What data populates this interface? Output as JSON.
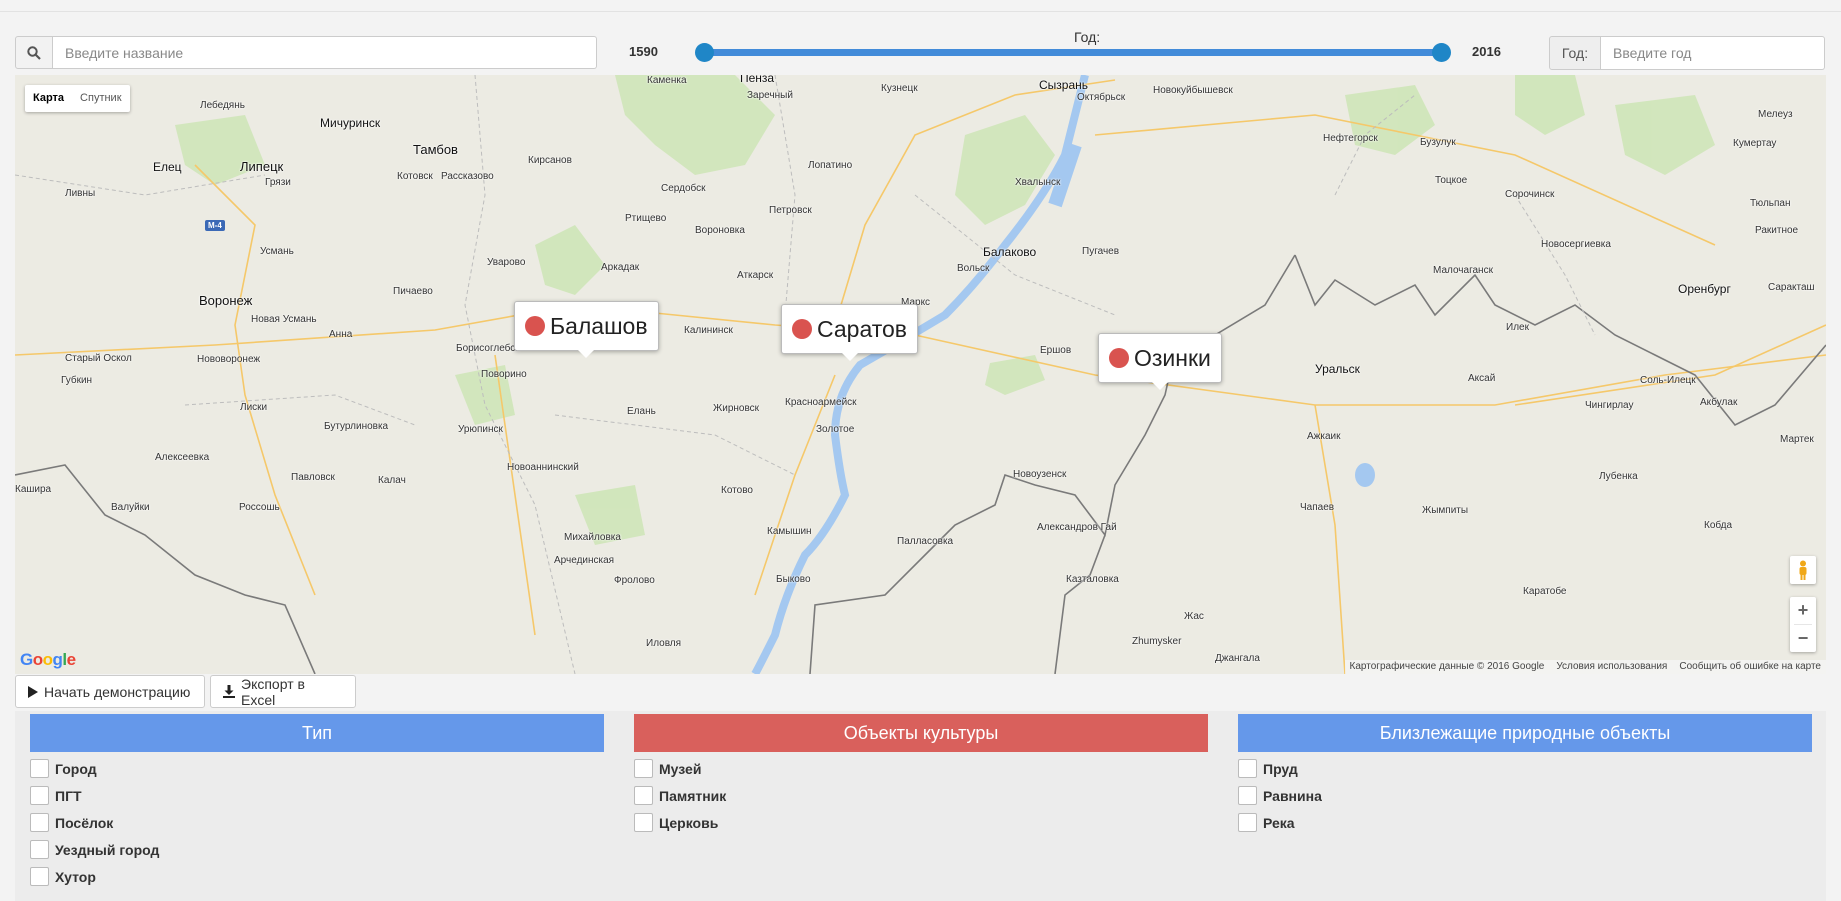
{
  "search": {
    "placeholder": "Введите название"
  },
  "year_slider": {
    "label": "Год:",
    "min": "1590",
    "max": "2016"
  },
  "year_filter": {
    "addon": "Год:",
    "placeholder": "Введите год"
  },
  "map": {
    "type_controls": [
      "Карта",
      "Спутник"
    ],
    "active_type": "Карта",
    "attribution": [
      "Картографические данные © 2016 Google",
      "Условия использования",
      "Сообщить об ошибке на карте"
    ],
    "logo": "Google",
    "zoom_in": "+",
    "zoom_out": "−",
    "road_badge": "M-4",
    "markers": [
      {
        "name": "Балашов"
      },
      {
        "name": "Саратов"
      },
      {
        "name": "Озинки"
      }
    ],
    "places": [
      "Каменка",
      "Пенза",
      "Заречный",
      "Кузнецк",
      "Сызрань",
      "Новокуйбышевск",
      "Октябрьск",
      "Лебедянь",
      "Мичуринск",
      "Тамбов",
      "Кирсанов",
      "Лопатино",
      "Хвалынск",
      "Мелеуз",
      "Кумертау",
      "Нефтегорск",
      "Бузулук",
      "Елец",
      "Липецк",
      "Котовск",
      "Рассказово",
      "Грязи",
      "Сердобск",
      "Ливны",
      "Петровск",
      "Ртищево",
      "Вольск",
      "Балаково",
      "Пугачев",
      "Тоцкое",
      "Сорочинск",
      "Тюльпан",
      "Усмань",
      "Уварово",
      "Аркадак",
      "Аткарск",
      "Маркс",
      "Новосергиевка",
      "Малочаганск",
      "Оренбург",
      "Саракташ",
      "Воронеж",
      "Новая Усмань",
      "Пичаево",
      "Калининск",
      "Анна",
      "Борисоглебск",
      "Ершов",
      "Илек",
      "Старый Оскол",
      "Нововоронеж",
      "Поворино",
      "Уральск",
      "Аксай",
      "Соль-Илецк",
      "Губкин",
      "Лиски",
      "Елань",
      "Жирновск",
      "Красноармейск",
      "Чингирлау",
      "Акбулак",
      "Бутурлиновка",
      "Урюпинск",
      "Золотое",
      "Ажкаик",
      "Мартек",
      "Алексеевка",
      "Павловск",
      "Калач",
      "Новоаннинский",
      "Новоузенск",
      "Лубенка",
      "Валуйки",
      "Россошь",
      "Котово",
      "Чапаев",
      "Жымпиты",
      "Кобда",
      "Михайловка",
      "Камышин",
      "Палласовка",
      "Александров Гай",
      "Арчединская",
      "Быково",
      "Фролово",
      "Казталовка",
      "Каратобе",
      "Жас",
      "Zhumysker",
      "Иловля",
      "Джангала",
      "Ракитное",
      "Вороновка",
      "Кашира"
    ]
  },
  "actions": {
    "demo": "Начать демонстрацию",
    "export": "Экспорт в Excel"
  },
  "filters": [
    {
      "title": "Тип",
      "color": "#6598ea",
      "items": [
        "Город",
        "ПГТ",
        "Посёлок",
        "Уездный город",
        "Хутор"
      ]
    },
    {
      "title": "Объекты культуры",
      "color": "#d9605c",
      "items": [
        "Музей",
        "Памятник",
        "Церковь"
      ]
    },
    {
      "title": "Близлежащие природные объекты",
      "color": "#6598ea",
      "items": [
        "Пруд",
        "Равнина",
        "Река"
      ]
    }
  ]
}
